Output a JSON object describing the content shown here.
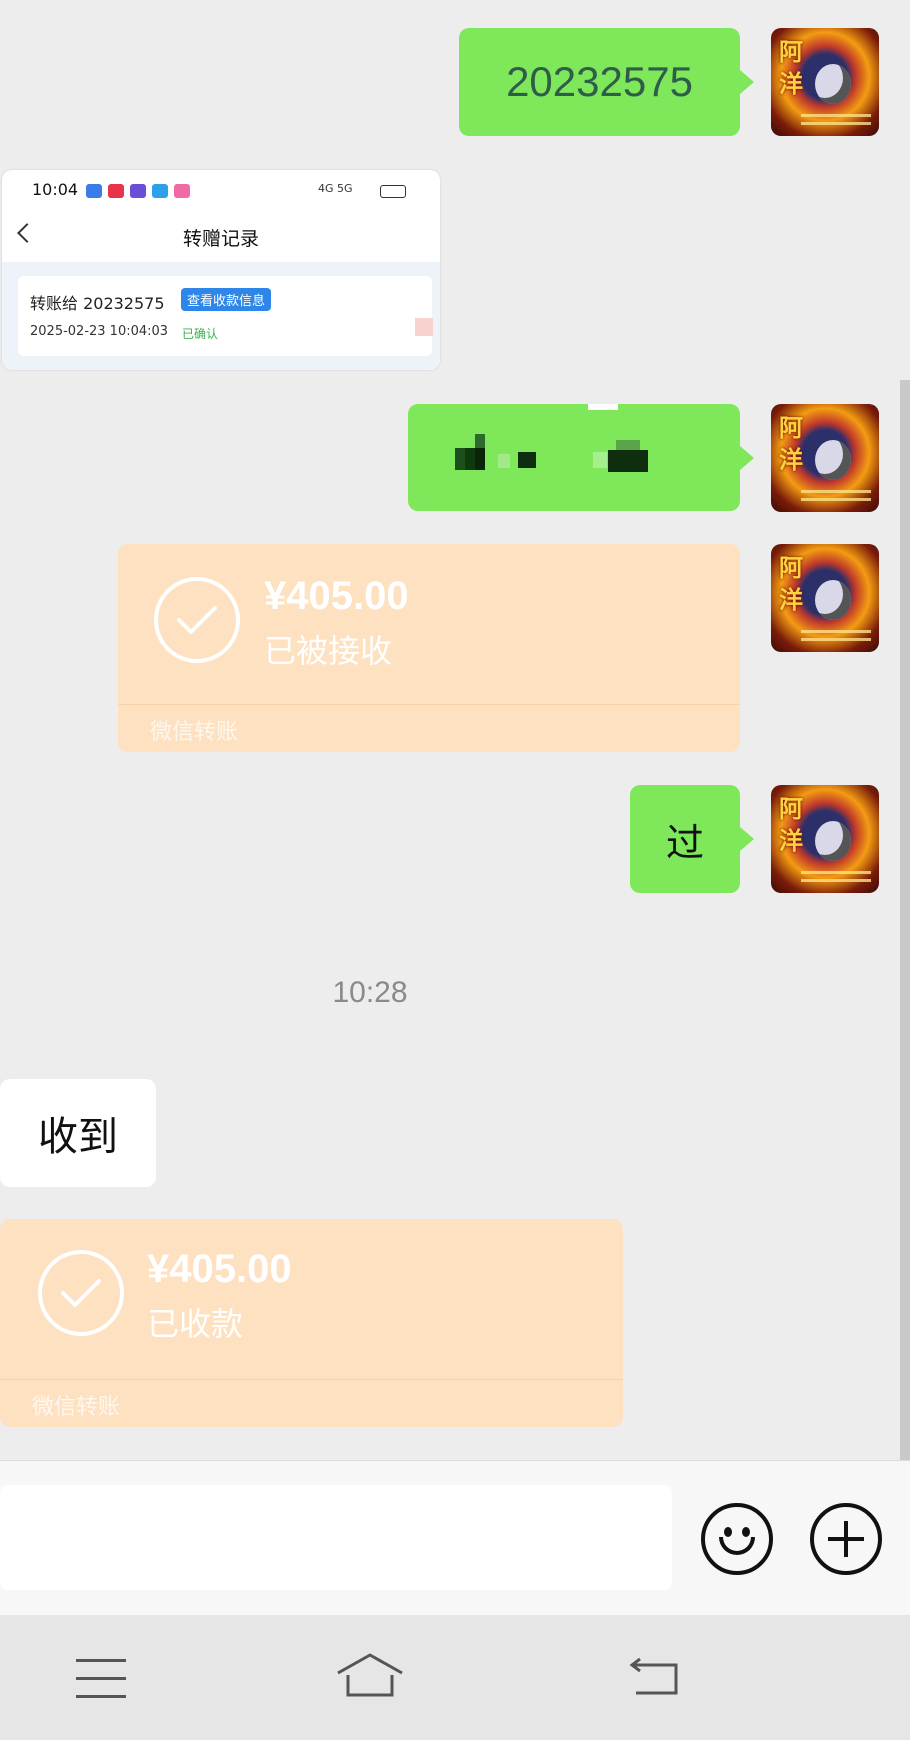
{
  "messages": {
    "sent_id_text": "20232575",
    "sent_short_text": "过",
    "received_text": "收到",
    "timestamp": "10:28"
  },
  "screenshot_card": {
    "status_time": "10:04",
    "status_right": "4G 5G",
    "title": "转赠记录",
    "record_label": "转账给 20232575",
    "record_button": "查看收款信息",
    "record_datetime": "2025-02-23 10:04:03",
    "record_status": "已确认"
  },
  "transfer_sent": {
    "amount": "¥405.00",
    "status": "已被接收",
    "footer": "微信转账"
  },
  "transfer_received": {
    "amount": "¥405.00",
    "status": "已收款",
    "footer": "微信转账"
  },
  "avatar": {
    "char_top": "阿",
    "char_bottom": "洋"
  },
  "input_bar": {
    "emoji_icon": "emoji-face-icon",
    "plus_icon": "plus-circle-icon"
  },
  "nav": {
    "menu_icon": "menu-icon",
    "home_icon": "home-icon",
    "back_icon": "back-icon"
  },
  "colors": {
    "background": "#ededed",
    "sent_bubble": "#7ee85a",
    "transfer_card": "#fde1c0",
    "input_bar": "#f7f7f7"
  }
}
